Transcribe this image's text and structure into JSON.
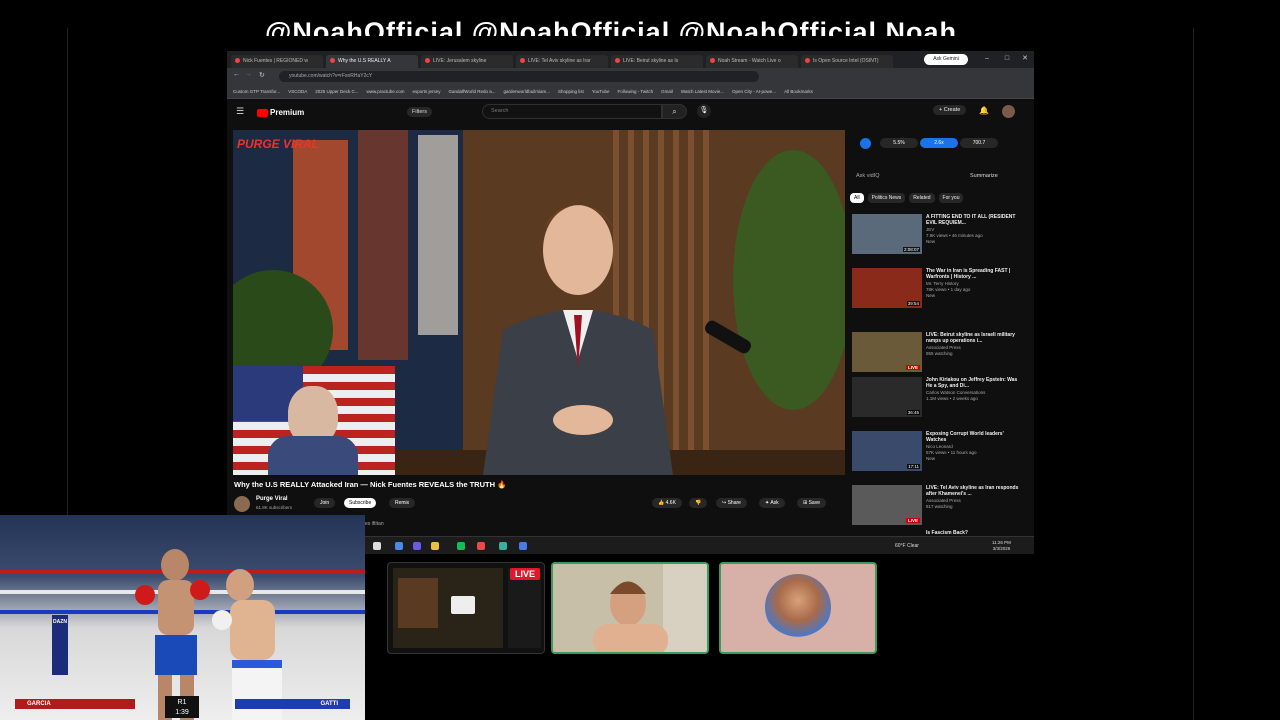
{
  "overlay": {
    "banner_text": "@NoahOfficial @NoahOfficial @NoahOfficial Noah"
  },
  "browser": {
    "tabs": [
      {
        "label": "Nick Fuentes | REGIONED w"
      },
      {
        "label": "Why the U.S REALLY A"
      },
      {
        "label": "LIVE: Jerusalem skyline"
      },
      {
        "label": "LIVE: Tel Aviv skyline as Irar"
      },
      {
        "label": "LIVE: Beirut skyline as Is"
      },
      {
        "label": "Noah Stream - Watch Live o"
      },
      {
        "label": "Is Open Source Intel (OSINT)"
      }
    ],
    "ask_gemini": "Ask Gemini",
    "url": "youtube.com/watch?v=rFsnRHaY2cY",
    "bookmarks": [
      "Custom GTP Transfor...",
      "VSCODA",
      "2025 Upper Deck C...",
      "www.practube.com",
      "esports jersey",
      "GandalfWorld Redo a...",
      "gardenworldbuilmiam...",
      "Shopping list",
      "YouTube",
      "Following - Twitch",
      "Gmail",
      "Watch Latest Movie...",
      "Open City - AI-powe...",
      "All Bookmarks"
    ]
  },
  "youtube": {
    "logo_text": "Premium",
    "filters": "Filters",
    "search_placeholder": "Search",
    "create": "Create",
    "video_title": "Why the U.S REALLY Attacked Iran — Nick Fuentes REVEALS the TRUTH 🔥",
    "overlay_brand": "PURGE VIRAL",
    "channel": {
      "name": "Purge Viral",
      "subscribers": "61.8K subscribers"
    },
    "buttons": {
      "join": "Join",
      "subscribe": "Subscribe",
      "remix": "Remix",
      "likes": "4.6K",
      "share": "Share",
      "ask": "Ask",
      "save": "Save"
    },
    "transcript_label": "es iftitan",
    "sidebar_stats": [
      "5.5%",
      "2.6x",
      "700.7"
    ],
    "ask_vidiq": "Ask vidIQ",
    "summarize": "Summarize",
    "chips": [
      "All",
      "Politics News",
      "Related",
      "For you"
    ],
    "recommendations": [
      {
        "title": "A FITTING END TO IT ALL (RESIDENT EVIL REQUIEM...",
        "channel": "JEV",
        "meta": "7.9K views • 46 minutes ago",
        "badge": "New",
        "duration": "2:08:07",
        "thumb_color": "#5a6a7a"
      },
      {
        "title": "The War in Iran is Spreading FAST | Warfronts | History ...",
        "channel": "Mr. Terry History",
        "meta": "78K views • 1 day ago",
        "badge": "New",
        "duration": "39:54",
        "thumb_color": "#8a2a1a"
      },
      {
        "title": "LIVE: Beirut skyline as Israeli military ramps up operations i...",
        "channel": "Associated Press",
        "meta": "955 watching",
        "badge": "LIVE",
        "duration": "LIVE",
        "thumb_color": "#6a5a3a"
      },
      {
        "title": "John Kiriakou on Jeffrey Epstein: Was He a Spy, and Di...",
        "channel": "Carlos Watson Conversations",
        "meta": "1.1M views • 2 weeks ago",
        "badge": "",
        "duration": "36:45",
        "thumb_color": "#2a2a2a"
      },
      {
        "title": "Exposing Corrupt World leaders' Watches",
        "channel": "Nico Leonard",
        "meta": "57K views • 11 hours ago",
        "badge": "New",
        "duration": "17:11",
        "thumb_color": "#3a4a6a"
      },
      {
        "title": "LIVE: Tel Aviv skyline as Iran responds after Khamenei's ...",
        "channel": "Associated Press",
        "meta": "817 watching",
        "badge": "LIVE",
        "duration": "LIVE",
        "thumb_color": "#5a5a5a"
      },
      {
        "title": "Is Fascism Back?",
        "channel": "",
        "meta": "",
        "badge": "",
        "duration": "",
        "thumb_color": "#333"
      }
    ]
  },
  "taskbar": {
    "weather": "60°F Clear",
    "time": "11:26 PM",
    "date": "3/3/2026"
  },
  "game": {
    "brand": "DAZN",
    "fighter_left": "GARCIA",
    "fighter_right": "GATTI",
    "round": "R1",
    "clock": "1:39"
  },
  "cams": {
    "live_badge": "LIVE"
  },
  "colors": {
    "youtube_red": "#ff0000",
    "live_red": "#e0182c",
    "cam_border": "#3b9b5a",
    "vidiq_blue": "#1a73e8"
  }
}
